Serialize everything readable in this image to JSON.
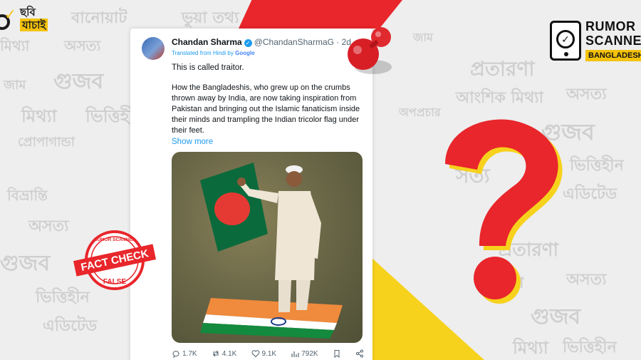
{
  "logo_left": {
    "line1": "ছবি",
    "line2": "যাচাই"
  },
  "logo_right": {
    "line1": "RUMOR",
    "line2": "SCANNER",
    "line3": "BANGLADESH"
  },
  "background_words": [
    "বানোয়াট",
    "ভুয়া তথ্য",
    "অসত্য",
    "মিথ্যা",
    "গুজব",
    "জাম",
    "প্রোপাগান্ডা",
    "ভিত্তিহীন",
    "এডিটেড",
    "বিভ্রান্তি",
    "প্রতারণা",
    "আংশিক মিথ্যা",
    "অপপ্রচার",
    "সত্য",
    "অসত্য",
    "মিথ্যা"
  ],
  "tweet": {
    "author_name": "Chandan Sharma",
    "handle": "@ChandanSharmaG · 2d",
    "translated_prefix": "Translated from Hindi by",
    "translated_brand": "Google",
    "paragraph1": "This is called traitor.",
    "paragraph2": "How the Bangladeshis, who grew up on the crumbs thrown away by India, are now taking inspiration from Pakistan and bringing out the Islamic fanaticism inside their minds and trampling the Indian tricolor flag under their feet.",
    "show_more": "Show more",
    "stats": {
      "replies": "1.7K",
      "reposts": "4.1K",
      "likes": "9.1K",
      "views": "792K"
    }
  },
  "stamp": {
    "top": "RUMOR SCANNER",
    "middle": "FACT CHECK",
    "bottom": "FALSE"
  },
  "colors": {
    "accent_red": "#e8262b",
    "accent_yellow": "#f7d21c",
    "link_blue": "#1d9bf0",
    "flag_green": "#0b6a3b",
    "flag_red": "#e53a33",
    "saffron": "#f08a3c"
  }
}
